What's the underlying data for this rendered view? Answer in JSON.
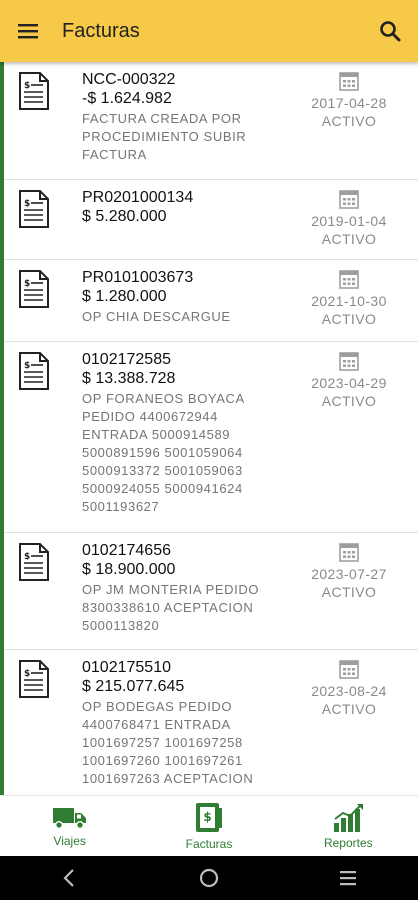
{
  "appbar": {
    "title": "Facturas",
    "menu_icon": "hamburger-menu-icon",
    "search_icon": "search-icon",
    "color": "#F7C948"
  },
  "invoices": [
    {
      "code": "NCC-000322",
      "amount": "-$ 1.624.982",
      "desc_lines": [
        "FACTURA CREADA POR",
        "PROCEDIMIENTO SUBIR",
        "FACTURA"
      ],
      "date": "2017-04-28",
      "status": "ACTIVO"
    },
    {
      "code": "PR0201000134",
      "amount": "$ 5.280.000",
      "desc_lines": [],
      "date": "2019-01-04",
      "status": "ACTIVO"
    },
    {
      "code": "PR0101003673",
      "amount": "$ 1.280.000",
      "desc_lines": [
        "OP CHIA DESCARGUE"
      ],
      "date": "2021-10-30",
      "status": "ACTIVO"
    },
    {
      "code": "0102172585",
      "amount": "$ 13.388.728",
      "desc_lines": [
        "OP FORANEOS BOYACA",
        "PEDIDO 4400672944",
        "ENTRADA 5000914589",
        "5000891596 5001059064",
        "5000913372 5001059063",
        "5000924055 5000941624",
        "5001193627"
      ],
      "date": "2023-04-29",
      "status": "ACTIVO"
    },
    {
      "code": "0102174656",
      "amount": "$ 18.900.000",
      "desc_lines": [
        "OP JM MONTERIA PEDIDO",
        "8300338610 ACEPTACION",
        "5000113820"
      ],
      "date": "2023-07-27",
      "status": "ACTIVO"
    },
    {
      "code": "0102175510",
      "amount": "$ 215.077.645",
      "desc_lines": [
        "OP BODEGAS PEDIDO",
        "4400768471 ENTRADA",
        "1001697257 1001697258",
        "1001697260 1001697261",
        "1001697263 ACEPTACION"
      ],
      "date": "2023-08-24",
      "status": "ACTIVO"
    }
  ],
  "bottom_nav": [
    {
      "label": "Viajes",
      "icon": "truck-icon"
    },
    {
      "label": "Facturas",
      "icon": "invoice-icon"
    },
    {
      "label": "Reportes",
      "icon": "bar-chart-icon"
    }
  ],
  "system_nav": [
    "back-icon",
    "home-icon",
    "recents-icon"
  ],
  "colors": {
    "accent_green": "#2E7D32",
    "text_gray": "#8a8a8a"
  }
}
